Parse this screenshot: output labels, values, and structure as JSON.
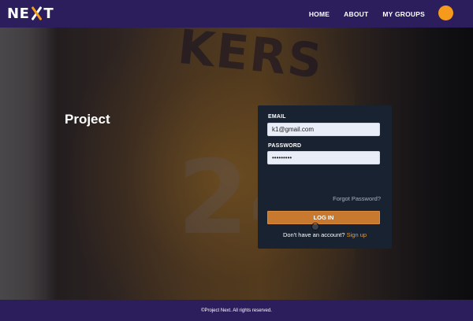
{
  "header": {
    "logo": {
      "left": "NE",
      "right": "T"
    },
    "nav": [
      "HOME",
      "ABOUT",
      "MY GROUPS"
    ],
    "avatar_color": "#f59a1b"
  },
  "hero": {
    "title": "Project",
    "background_text": "KERS",
    "background_number": "24"
  },
  "login": {
    "email_label": "EMAIL",
    "email_value": "k1@gmail.com",
    "password_label": "PASSWORD",
    "password_value": "•••••••••",
    "forgot_label": "Forgot Password?",
    "button_label": "LOG IN",
    "signup_prompt": "Don't have an account?",
    "signup_link": "Sign up"
  },
  "footer": {
    "text": "©Project Next. All rights reserved."
  },
  "colors": {
    "nav_bg": "#2c1e5c",
    "accent": "#f59a1b",
    "button": "#c7792f",
    "card_bg": "#192230"
  }
}
